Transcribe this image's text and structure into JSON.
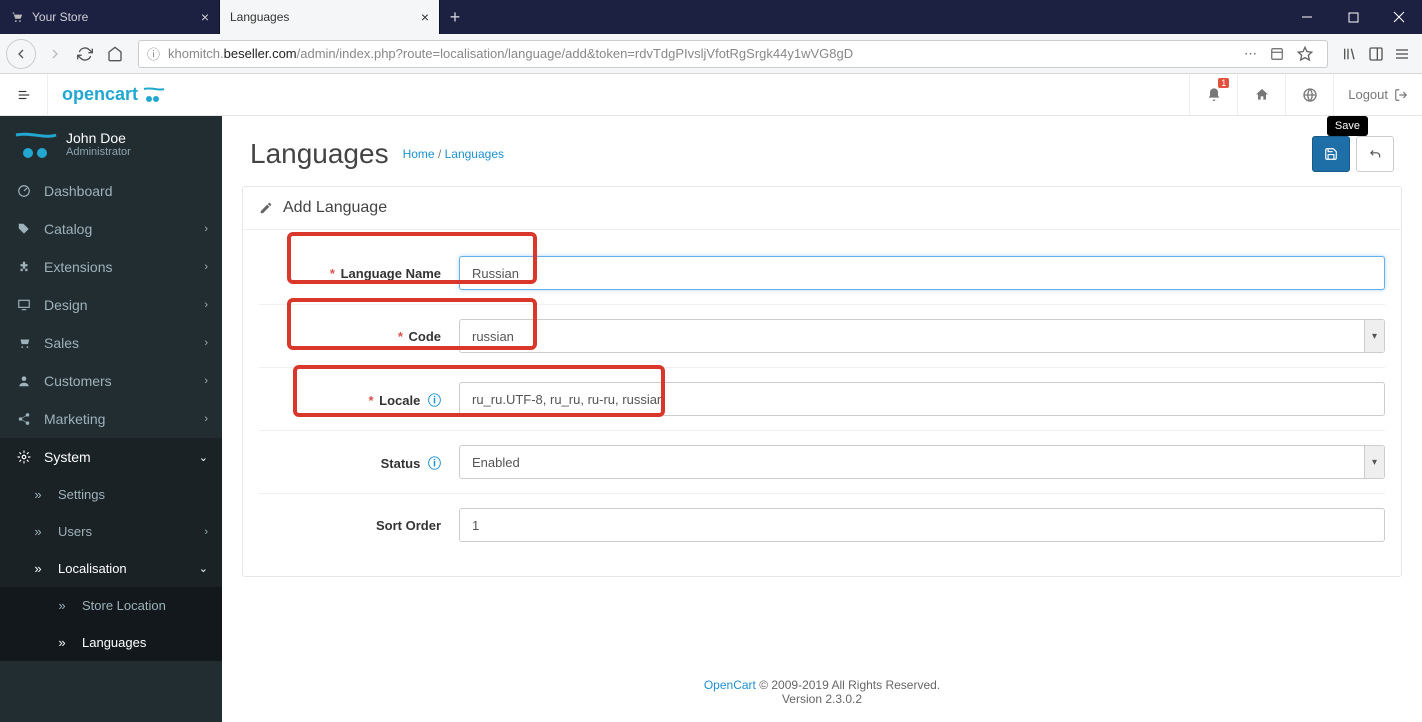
{
  "browser": {
    "tabs": [
      {
        "title": "Your Store",
        "active": false
      },
      {
        "title": "Languages",
        "active": true
      }
    ],
    "url_domain": "khomitch.beseller.com",
    "url_path": "/admin/index.php?route=localisation/language/add&token=rdvTdgPIvsljVfotRgSrgk44y1wVG8gD"
  },
  "header": {
    "logo": "opencart",
    "notifications_badge": "1",
    "logout": "Logout",
    "save_tooltip": "Save"
  },
  "user": {
    "name": "John Doe",
    "role": "Administrator"
  },
  "sidebar": {
    "items": [
      {
        "label": "Dashboard",
        "icon": "dashboard"
      },
      {
        "label": "Catalog",
        "icon": "tag",
        "children": true
      },
      {
        "label": "Extensions",
        "icon": "puzzle",
        "children": true
      },
      {
        "label": "Design",
        "icon": "monitor",
        "children": true
      },
      {
        "label": "Sales",
        "icon": "cart",
        "children": true
      },
      {
        "label": "Customers",
        "icon": "user",
        "children": true
      },
      {
        "label": "Marketing",
        "icon": "share",
        "children": true
      },
      {
        "label": "System",
        "icon": "gear",
        "children": true,
        "open": true
      }
    ],
    "system_sub": [
      {
        "label": "Settings"
      },
      {
        "label": "Users",
        "children": true
      },
      {
        "label": "Localisation",
        "children": true,
        "open": true
      }
    ],
    "localisation_sub": [
      {
        "label": "Store Location"
      },
      {
        "label": "Languages",
        "active": true
      }
    ]
  },
  "page": {
    "title": "Languages",
    "breadcrumb_home": "Home",
    "breadcrumb_current": "Languages",
    "panel_title": "Add Language"
  },
  "form": {
    "language_name": {
      "label": "Language Name",
      "value": "Russian",
      "required": true
    },
    "code": {
      "label": "Code",
      "value": "russian",
      "required": true
    },
    "locale": {
      "label": "Locale",
      "value": "ru_ru.UTF-8, ru_ru, ru-ru, russian",
      "required": true,
      "help": true
    },
    "status": {
      "label": "Status",
      "value": "Enabled",
      "help": true
    },
    "sort_order": {
      "label": "Sort Order",
      "value": "1"
    }
  },
  "footer": {
    "link": "OpenCart",
    "copyright": " © 2009-2019 All Rights Reserved.",
    "version": "Version 2.3.0.2"
  }
}
